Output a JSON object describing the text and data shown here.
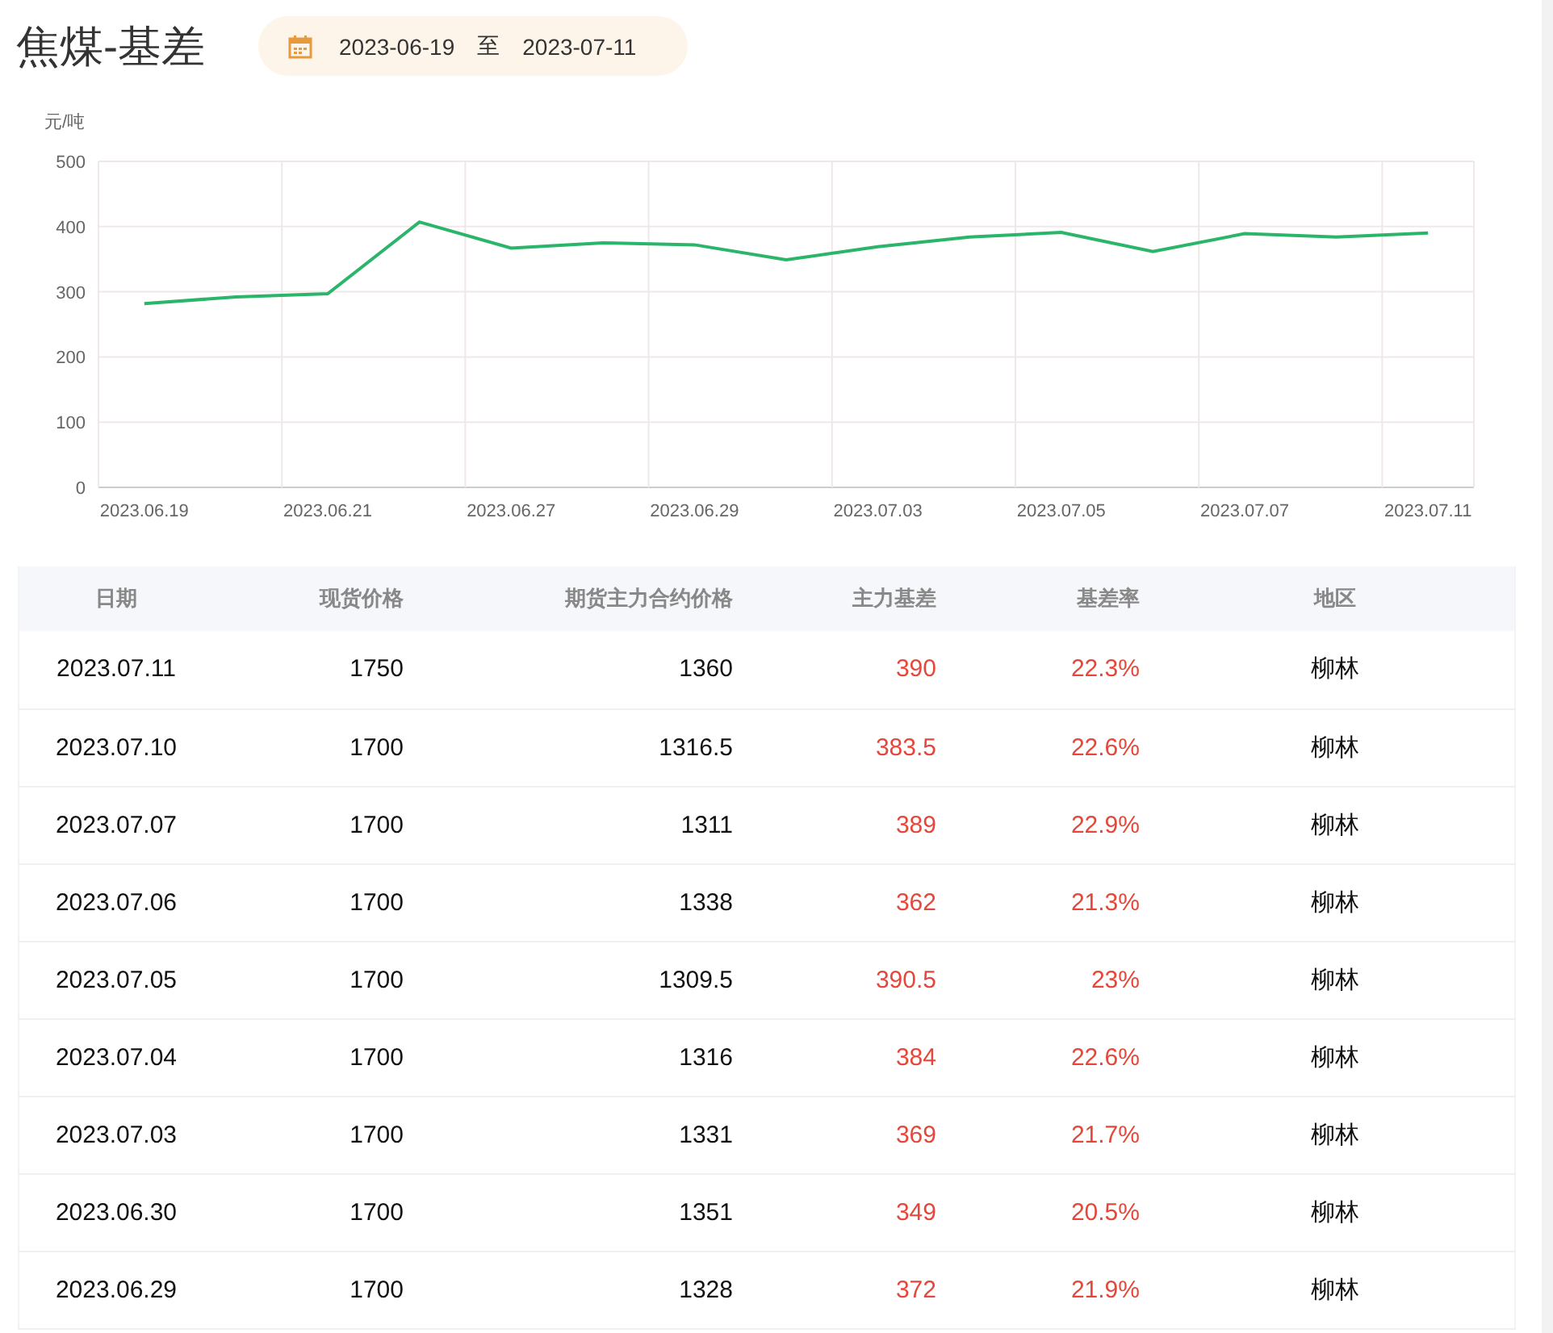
{
  "title": "焦煤-基差",
  "date_range": {
    "start": "2023-06-19",
    "separator": "至",
    "end": "2023-07-11"
  },
  "chart_data": {
    "type": "line",
    "ylabel": "元/吨",
    "categories": [
      "2023.06.19",
      null,
      "2023.06.21",
      null,
      "2023.06.27",
      null,
      "2023.06.29",
      null,
      "2023.07.03",
      null,
      "2023.07.05",
      null,
      "2023.07.07",
      null,
      "2023.07.11"
    ],
    "series": [
      {
        "color": "#2ab56a",
        "values": [
          282,
          292,
          297,
          407,
          367,
          375,
          372,
          349,
          369,
          384,
          391,
          362,
          389,
          384,
          390
        ]
      }
    ],
    "grid": true,
    "ylim": [
      0,
      500
    ],
    "yticks": [
      0,
      100,
      200,
      300,
      400,
      500
    ]
  },
  "table": {
    "columns": [
      "日期",
      "现货价格",
      "期货主力合约价格",
      "主力基差",
      "基差率",
      "地区"
    ],
    "rows": [
      [
        "2023.07.11",
        "1750",
        "1360",
        "390",
        "22.3%",
        "柳林"
      ],
      [
        "2023.07.10",
        "1700",
        "1316.5",
        "383.5",
        "22.6%",
        "柳林"
      ],
      [
        "2023.07.07",
        "1700",
        "1311",
        "389",
        "22.9%",
        "柳林"
      ],
      [
        "2023.07.06",
        "1700",
        "1338",
        "362",
        "21.3%",
        "柳林"
      ],
      [
        "2023.07.05",
        "1700",
        "1309.5",
        "390.5",
        "23%",
        "柳林"
      ],
      [
        "2023.07.04",
        "1700",
        "1316",
        "384",
        "22.6%",
        "柳林"
      ],
      [
        "2023.07.03",
        "1700",
        "1331",
        "369",
        "21.7%",
        "柳林"
      ],
      [
        "2023.06.30",
        "1700",
        "1351",
        "349",
        "20.5%",
        "柳林"
      ],
      [
        "2023.06.29",
        "1700",
        "1328",
        "372",
        "21.9%",
        "柳林"
      ]
    ]
  }
}
